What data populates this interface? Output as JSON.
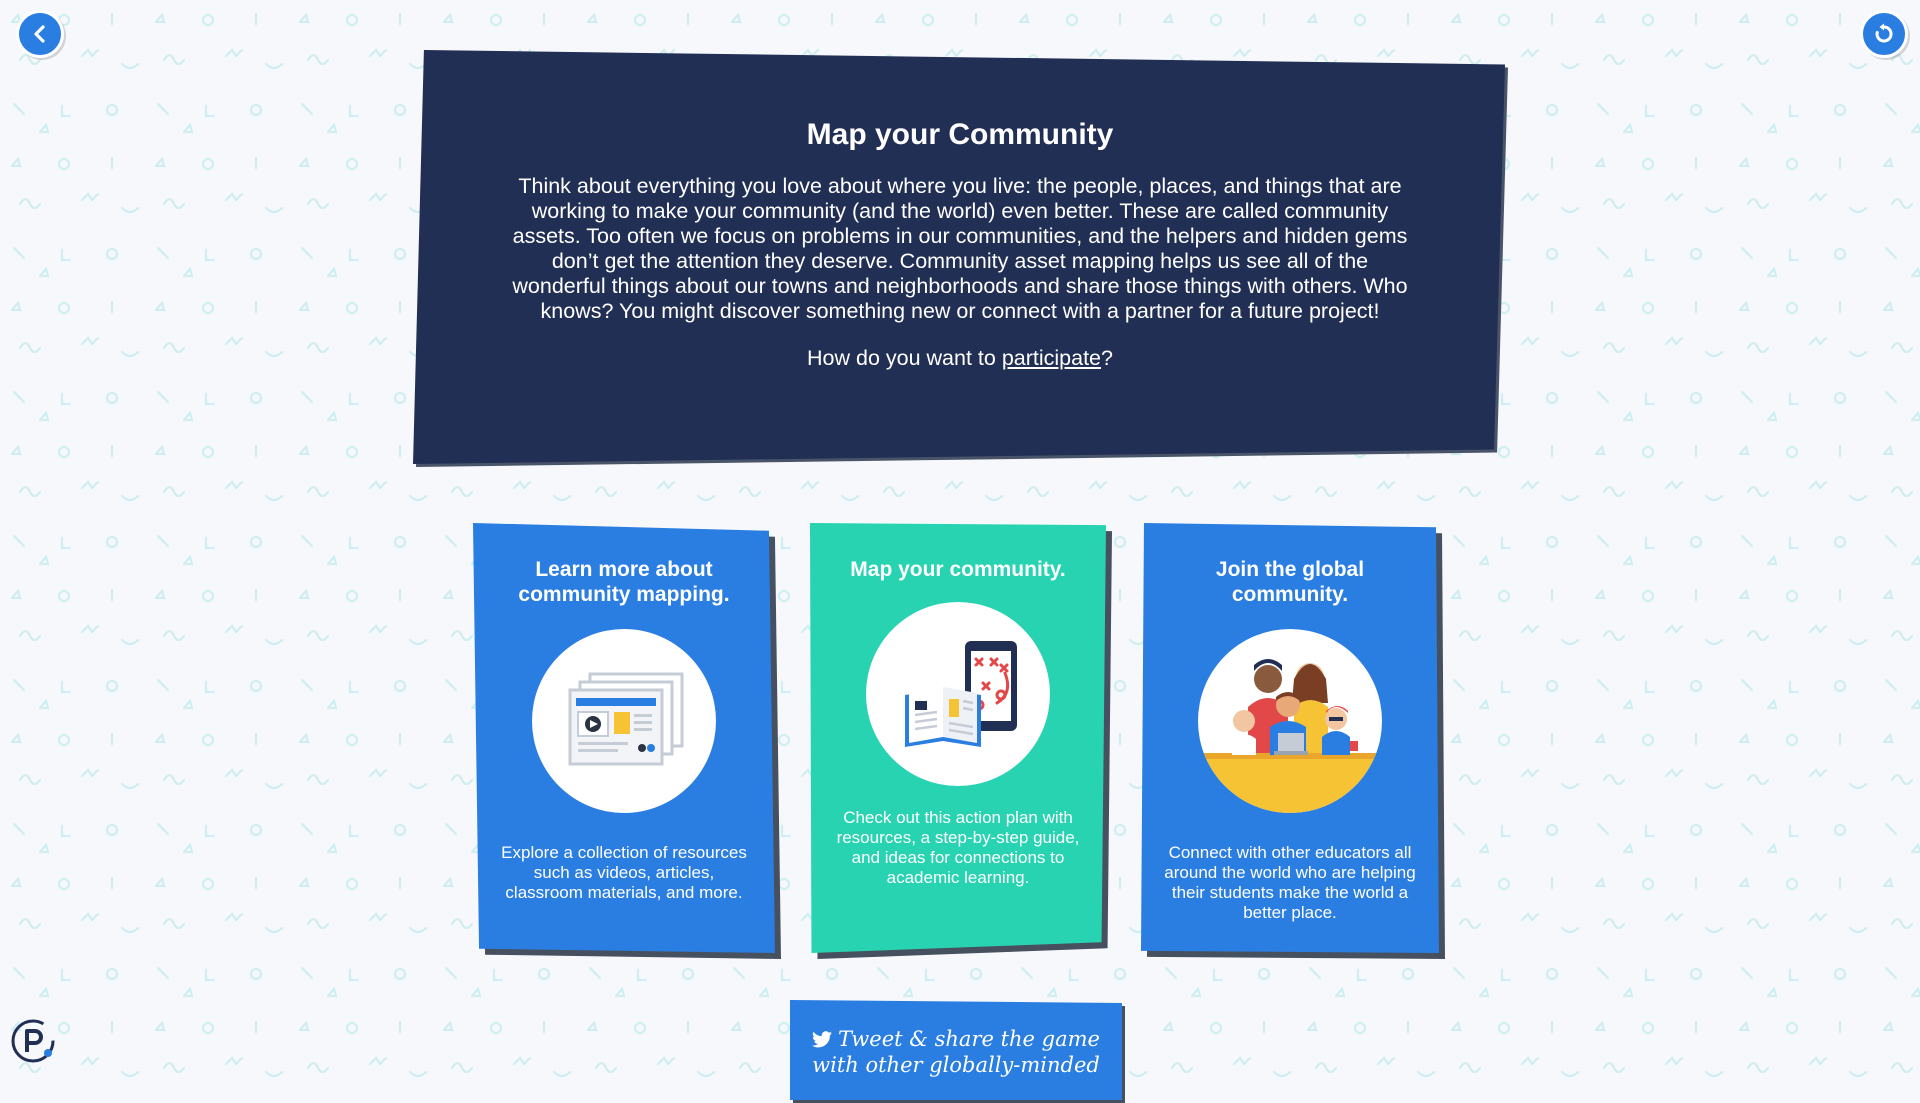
{
  "header": {
    "title": "Map your Community",
    "body": "Think about everything you love about where you live: the people, places, and things that are working to make your community (and the world) even better. These are called community assets. Too often we focus on problems in our communities, and the helpers and hidden gems don’t get the attention they deserve. Community asset mapping helps us see all of the wonderful things about our towns and neighborhoods and share those things with others. Who knows? You might discover something new or connect with a partner for a future project!",
    "question_prefix": "How do you want to ",
    "question_link": "participate",
    "question_suffix": "?"
  },
  "nav": {
    "back_icon": "chevron-left-icon",
    "restart_icon": "restart-icon"
  },
  "cards": [
    {
      "title": "Learn more about community mapping.",
      "description": "Explore a collection of resources such as videos, articles, classroom materials, and more.",
      "icon": "resources-collection-icon",
      "color": "#2a7de1"
    },
    {
      "title": "Map your community.",
      "description": "Check out this action plan with resources, a step-by-step guide, and ideas for connections to academic learning.",
      "icon": "action-plan-icon",
      "color": "#27d3b0"
    },
    {
      "title": "Join the global community.",
      "description": "Connect with other educators all around the world who are helping their students make the world a better place.",
      "icon": "global-community-icon",
      "color": "#2a7de1"
    }
  ],
  "tweet": {
    "label": "Tweet & share the game with other globally-minded",
    "icon": "twitter-icon"
  },
  "colors": {
    "panel": "#222f55",
    "blue": "#2a7de1",
    "teal": "#27d3b0",
    "pattern": "#c9ecef"
  },
  "brand": {
    "logo_icon": "p-logo-icon"
  }
}
